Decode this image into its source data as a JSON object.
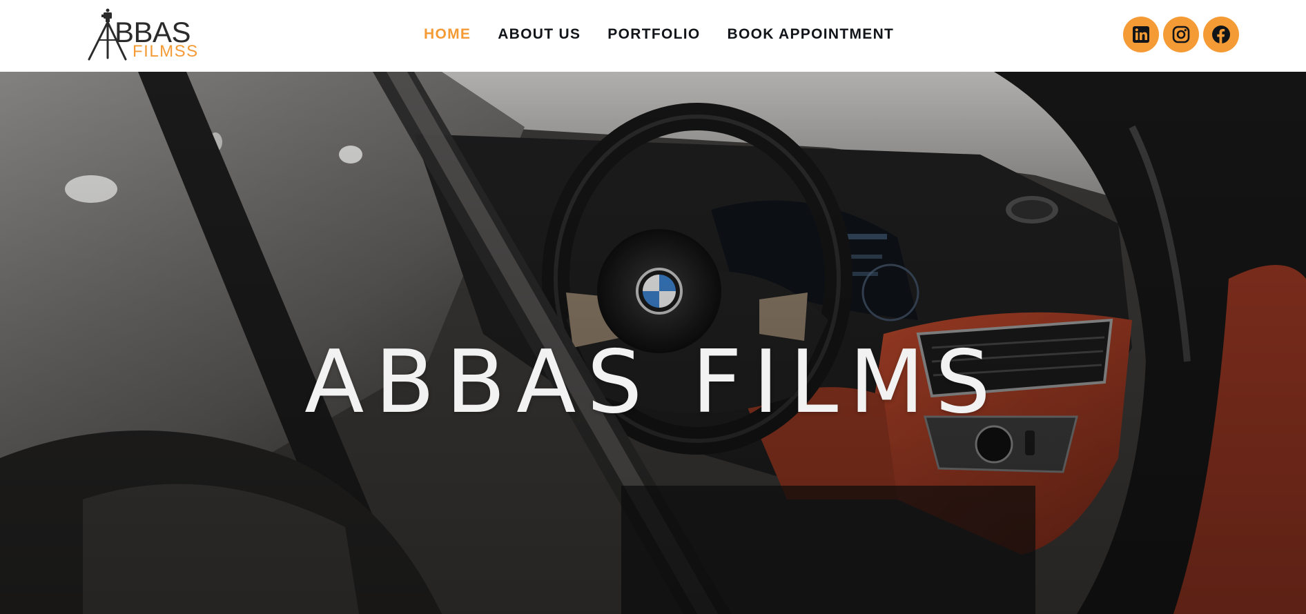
{
  "brand": {
    "logo_word": "BBAS",
    "logo_sub": "FILMSS",
    "logo_icon": "tripod-camera-icon",
    "accent_color": "#f59b36",
    "text_color": "#111418"
  },
  "nav": {
    "items": [
      {
        "label": "HOME",
        "active": true
      },
      {
        "label": "ABOUT US",
        "active": false
      },
      {
        "label": "PORTFOLIO",
        "active": false
      },
      {
        "label": "BOOK APPOINTMENT",
        "active": false
      }
    ]
  },
  "social": {
    "items": [
      {
        "icon": "linkedin-icon"
      },
      {
        "icon": "instagram-icon"
      },
      {
        "icon": "facebook-icon"
      }
    ]
  },
  "hero": {
    "title": "ABBAS FILMS",
    "background": "car-interior-photo"
  }
}
